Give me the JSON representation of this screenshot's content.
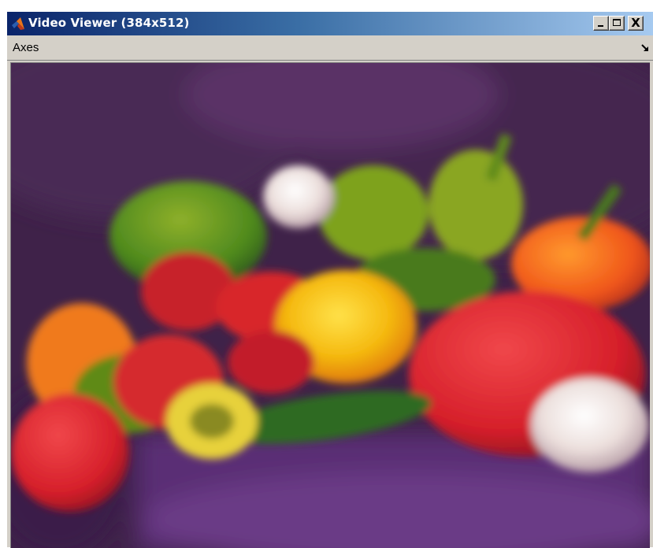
{
  "window": {
    "title": "Video Viewer (384x512)",
    "icon": "matlab-icon"
  },
  "caption_buttons": {
    "minimize_icon": "minimize-icon",
    "maximize_icon": "maximize-icon",
    "close_label": "X"
  },
  "menu": {
    "items": [
      {
        "label": "Axes"
      }
    ],
    "dock_icon": "dock-arrow-icon"
  },
  "video_frame": {
    "content": "peppers-image",
    "resolution": "384x512"
  },
  "colors": {
    "title_gradient_start": "#0a246a",
    "title_gradient_end": "#a6caf0",
    "chrome": "#d4d0c8",
    "backdrop": "#3b1f45"
  }
}
